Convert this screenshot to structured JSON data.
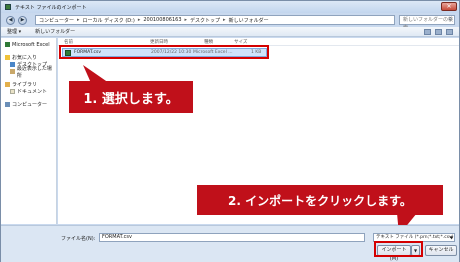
{
  "window": {
    "title": "テキスト ファイルのインポート",
    "close_label": "✕"
  },
  "nav": {
    "back_glyph": "◀",
    "forward_glyph": "▶",
    "breadcrumbs": [
      "コンピューター",
      "ローカル ディスク (D:)",
      "200100806163",
      "デスクトップ",
      "新しいフォルダー"
    ],
    "search_placeholder": "新しいフォルダーの検索"
  },
  "toolbar": {
    "organize_label": "整理 ▾",
    "new_folder_label": "新しいフォルダー"
  },
  "sidebar": {
    "top_item": "Microsoft Excel",
    "favorites_header": "お気に入り",
    "favorites": [
      "デスクトップ",
      "最近表示した場所"
    ],
    "libraries_header": "ライブラリ",
    "libraries": [
      "ドキュメント"
    ],
    "computer": "コンピューター"
  },
  "columns": {
    "name": "名前",
    "date": "更新日時",
    "type": "種類",
    "size": "サイズ"
  },
  "files": [
    {
      "name": "FORMAT.csv",
      "date": "2007/12/22 10:30",
      "type": "Microsoft Excel ...",
      "size": "1 KB"
    }
  ],
  "callouts": {
    "step1": "1. 選択します。",
    "step2": "2. インポートをクリックします。"
  },
  "bottom": {
    "filename_label": "ファイル名(N):",
    "filename_value": "FORMAT.csv",
    "filetype_value": "テキスト ファイル (*.prn;*.txt;*.csv)",
    "import_label": "インポート(M)",
    "cancel_label": "キャンセル"
  },
  "colors": {
    "accent_red": "#c0101a",
    "selection": "#cfe3fb"
  }
}
